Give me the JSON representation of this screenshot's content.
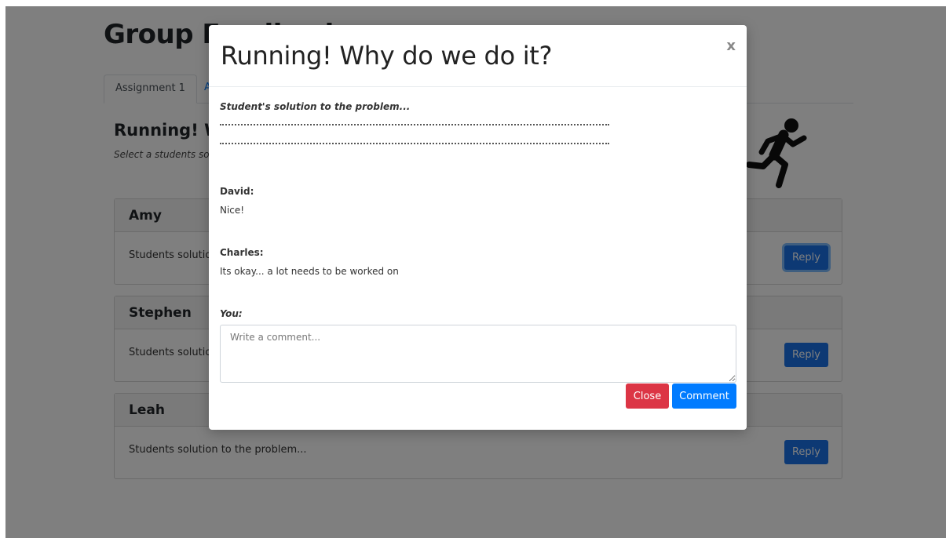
{
  "page": {
    "title": "Group Feedback",
    "tabs": [
      "Assignment 1",
      "Assignment 2"
    ],
    "assignment_title": "Running! Why do we do it?",
    "assignment_subtitle": "Select a students solution to give feedback",
    "runner_icon": "running-person-icon",
    "cards": [
      {
        "name": "Amy",
        "solution": "Students solution to the problem...",
        "reply_label": "Reply"
      },
      {
        "name": "Stephen",
        "solution": "Students solution to the problem...",
        "reply_label": "Reply"
      },
      {
        "name": "Leah",
        "solution": "Students solution to the problem...",
        "reply_label": "Reply"
      }
    ]
  },
  "modal": {
    "title": "Running! Why do we do it?",
    "close_icon": "x",
    "solution_label": "Student's solution to the problem...",
    "comments": [
      {
        "author": "David:",
        "text": "Nice!"
      },
      {
        "author": "Charles:",
        "text": "Its okay... a lot needs to be worked on"
      }
    ],
    "you_label": "You:",
    "comment_placeholder": "Write a comment...",
    "close_label": "Close",
    "comment_label": "Comment"
  },
  "colors": {
    "primary": "#007bff",
    "danger": "#dc3545",
    "overlay": "rgba(0,0,0,0.5)"
  }
}
